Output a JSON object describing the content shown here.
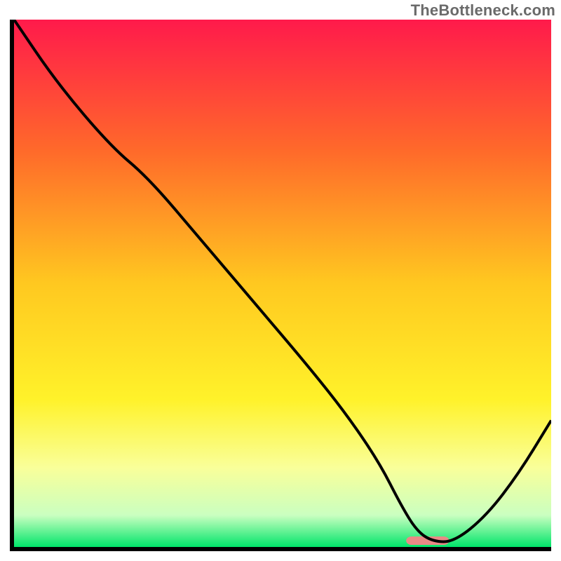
{
  "watermark": "TheBottleneck.com",
  "chart_data": {
    "type": "line",
    "title": "",
    "xlabel": "",
    "ylabel": "",
    "xlim": [
      0,
      100
    ],
    "ylim": [
      0,
      100
    ],
    "grid": false,
    "gradient_stops": [
      {
        "pct": 0,
        "color": "#ff1a4b"
      },
      {
        "pct": 25,
        "color": "#ff6a2a"
      },
      {
        "pct": 50,
        "color": "#ffc820"
      },
      {
        "pct": 72,
        "color": "#fff22a"
      },
      {
        "pct": 85,
        "color": "#f9ff9a"
      },
      {
        "pct": 94,
        "color": "#caffc0"
      },
      {
        "pct": 100,
        "color": "#00e56a"
      }
    ],
    "series": [
      {
        "name": "bottleneck-curve",
        "stroke": "#000000",
        "x": [
          0,
          8,
          18,
          25,
          35,
          45,
          55,
          62,
          68,
          72,
          75,
          78,
          82,
          88,
          94,
          100
        ],
        "y": [
          100,
          88,
          76,
          70,
          58,
          46,
          34,
          25,
          16,
          8,
          3,
          1,
          1,
          6,
          14,
          24
        ]
      }
    ],
    "marker": {
      "name": "optimal-range",
      "color": "#e98a86",
      "x_center": 77,
      "y": 1.2,
      "width": 8,
      "height": 1.6
    }
  }
}
